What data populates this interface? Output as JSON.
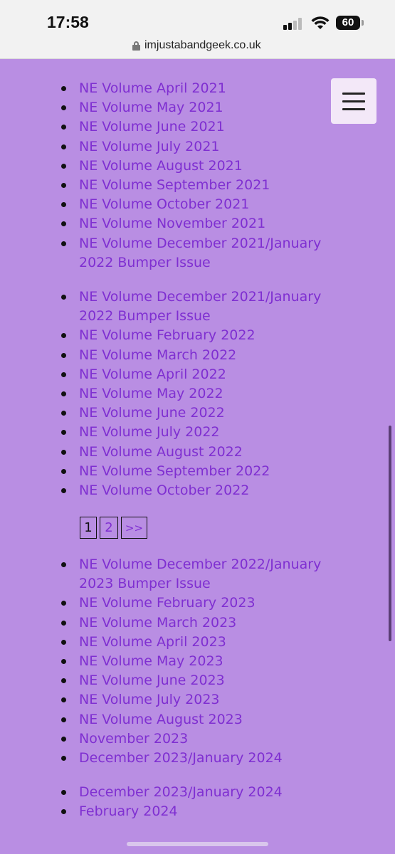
{
  "status_bar": {
    "time": "17:58",
    "battery": "60"
  },
  "browser": {
    "url": "imjustabandgeek.co.uk"
  },
  "menu": {
    "icon": "hamburger-menu-icon"
  },
  "list1": [
    "NE Volume April 2021",
    "NE Volume May 2021",
    "NE Volume June 2021",
    "NE Volume July 2021",
    "NE Volume August 2021",
    "NE Volume September 2021",
    "NE Volume October 2021",
    "NE Volume November 2021",
    "NE Volume December 2021/January 2022 Bumper Issue"
  ],
  "list2": [
    "NE Volume December 2021/January 2022 Bumper Issue",
    "NE Volume February 2022",
    "NE Volume March 2022",
    "NE Volume April 2022",
    "NE Volume May 2022",
    "NE Volume June 2022",
    "NE Volume July 2022",
    "NE Volume August 2022",
    "NE Volume September 2022",
    "NE Volume October 2022"
  ],
  "pagination": {
    "page1": "1",
    "page2": "2",
    "next": ">>"
  },
  "list3": [
    "NE Volume December 2022/January 2023 Bumper Issue",
    "NE Volume February 2023",
    "NE Volume March 2023",
    "NE Volume April 2023",
    "NE Volume May 2023",
    "NE Volume June 2023",
    "NE Volume July 2023",
    "NE Volume August 2023",
    "November 2023",
    "December 2023/January 2024"
  ],
  "list4": [
    "December 2023/January 2024",
    "February 2024"
  ],
  "colors": {
    "background": "#b98ee3",
    "link": "#7f2fd1",
    "menu_bg": "#f3e8f8"
  }
}
